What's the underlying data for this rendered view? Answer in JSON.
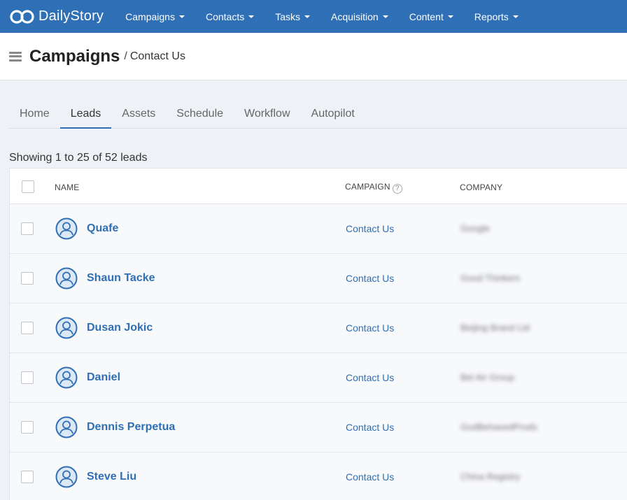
{
  "navbar": {
    "brand": "DailyStory",
    "items": [
      {
        "label": "Campaigns"
      },
      {
        "label": "Contacts"
      },
      {
        "label": "Tasks"
      },
      {
        "label": "Acquisition"
      },
      {
        "label": "Content"
      },
      {
        "label": "Reports"
      }
    ]
  },
  "header": {
    "title": "Campaigns",
    "separator": "/",
    "breadcrumb": "Contact Us"
  },
  "tabs": [
    {
      "label": "Home"
    },
    {
      "label": "Leads"
    },
    {
      "label": "Assets"
    },
    {
      "label": "Schedule"
    },
    {
      "label": "Workflow"
    },
    {
      "label": "Autopilot"
    }
  ],
  "active_tab": "Leads",
  "showing_text": "Showing 1 to 25 of 52 leads",
  "table": {
    "columns": {
      "name": "NAME",
      "campaign": "CAMPAIGN",
      "company": "COMPANY"
    },
    "help_glyph": "?",
    "rows": [
      {
        "name": "Quafe",
        "campaign": "Contact Us",
        "company": "Google"
      },
      {
        "name": "Shaun Tacke",
        "campaign": "Contact Us",
        "company": "Good Thinkers"
      },
      {
        "name": "Dusan Jokic",
        "campaign": "Contact Us",
        "company": "Beijing Brand Ltd"
      },
      {
        "name": "Daniel",
        "campaign": "Contact Us",
        "company": "Bel Air Group"
      },
      {
        "name": "Dennis Perpetua",
        "campaign": "Contact Us",
        "company": "GodBehavedProds"
      },
      {
        "name": "Steve Liu",
        "campaign": "Contact Us",
        "company": "China Registry"
      }
    ]
  },
  "colors": {
    "navbar": "#2f6fb5",
    "link": "#2f6fb5",
    "background": "#eef1f6"
  }
}
